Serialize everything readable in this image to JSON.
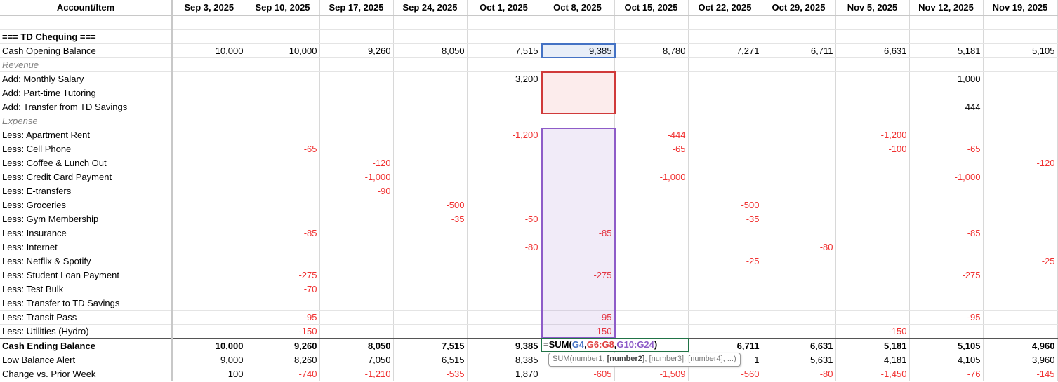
{
  "columns": [
    "Account/Item",
    "Sep 3, 2025",
    "Sep 10, 2025",
    "Sep 17, 2025",
    "Sep 24, 2025",
    "Oct 1, 2025",
    "Oct 8, 2025",
    "Oct 15, 2025",
    "Oct 22, 2025",
    "Oct 29, 2025",
    "Nov 5, 2025",
    "Nov 12, 2025",
    "Nov 19, 2025"
  ],
  "rows": [
    {
      "label": "",
      "style": "",
      "values": [
        "",
        "",
        "",
        "",
        "",
        "",
        "",
        "",
        "",
        "",
        "",
        ""
      ]
    },
    {
      "label": "=== TD Chequing ===",
      "style": "section",
      "values": [
        "",
        "",
        "",
        "",
        "",
        "",
        "",
        "",
        "",
        "",
        "",
        ""
      ]
    },
    {
      "label": "Cash Opening Balance",
      "style": "",
      "values": [
        "10,000",
        "10,000",
        "9,260",
        "8,050",
        "7,515",
        "9,385",
        "8,780",
        "7,271",
        "6,711",
        "6,631",
        "5,181",
        "5,105"
      ]
    },
    {
      "label": "Revenue",
      "style": "italic",
      "values": [
        "",
        "",
        "",
        "",
        "",
        "",
        "",
        "",
        "",
        "",
        "",
        ""
      ]
    },
    {
      "label": "Add: Monthly Salary",
      "style": "",
      "values": [
        "",
        "",
        "",
        "",
        "3,200",
        "",
        "",
        "",
        "",
        "",
        "1,000",
        ""
      ]
    },
    {
      "label": "Add: Part-time Tutoring",
      "style": "",
      "values": [
        "",
        "",
        "",
        "",
        "",
        "",
        "",
        "",
        "",
        "",
        "",
        ""
      ]
    },
    {
      "label": "Add: Transfer from TD Savings",
      "style": "",
      "values": [
        "",
        "",
        "",
        "",
        "",
        "",
        "",
        "",
        "",
        "",
        "444",
        ""
      ]
    },
    {
      "label": "Expense",
      "style": "italic",
      "values": [
        "",
        "",
        "",
        "",
        "",
        "",
        "",
        "",
        "",
        "",
        "",
        ""
      ]
    },
    {
      "label": "Less: Apartment Rent",
      "style": "",
      "values": [
        "",
        "",
        "",
        "",
        "-1,200",
        "",
        "-444",
        "",
        "",
        "-1,200",
        "",
        ""
      ]
    },
    {
      "label": "Less: Cell Phone",
      "style": "",
      "values": [
        "",
        "-65",
        "",
        "",
        "",
        "",
        "-65",
        "",
        "",
        "-100",
        "-65",
        ""
      ]
    },
    {
      "label": "Less: Coffee & Lunch Out",
      "style": "",
      "values": [
        "",
        "",
        "-120",
        "",
        "",
        "",
        "",
        "",
        "",
        "",
        "",
        "-120"
      ]
    },
    {
      "label": "Less: Credit Card Payment",
      "style": "",
      "values": [
        "",
        "",
        "-1,000",
        "",
        "",
        "",
        "-1,000",
        "",
        "",
        "",
        "-1,000",
        ""
      ]
    },
    {
      "label": "Less: E-transfers",
      "style": "",
      "values": [
        "",
        "",
        "-90",
        "",
        "",
        "",
        "",
        "",
        "",
        "",
        "",
        ""
      ]
    },
    {
      "label": "Less: Groceries",
      "style": "",
      "values": [
        "",
        "",
        "",
        "-500",
        "",
        "",
        "",
        "-500",
        "",
        "",
        "",
        ""
      ]
    },
    {
      "label": "Less: Gym Membership",
      "style": "",
      "values": [
        "",
        "",
        "",
        "-35",
        "-50",
        "",
        "",
        "-35",
        "",
        "",
        "",
        ""
      ]
    },
    {
      "label": "Less: Insurance",
      "style": "",
      "values": [
        "",
        "-85",
        "",
        "",
        "",
        "-85",
        "",
        "",
        "",
        "",
        "-85",
        ""
      ]
    },
    {
      "label": "Less: Internet",
      "style": "",
      "values": [
        "",
        "",
        "",
        "",
        "-80",
        "",
        "",
        "",
        "-80",
        "",
        "",
        ""
      ]
    },
    {
      "label": "Less: Netflix & Spotify",
      "style": "",
      "values": [
        "",
        "",
        "",
        "",
        "",
        "",
        "",
        "-25",
        "",
        "",
        "",
        "-25"
      ]
    },
    {
      "label": "Less: Student Loan Payment",
      "style": "",
      "values": [
        "",
        "-275",
        "",
        "",
        "",
        "-275",
        "",
        "",
        "",
        "",
        "-275",
        ""
      ]
    },
    {
      "label": "Less: Test Bulk",
      "style": "",
      "values": [
        "",
        "-70",
        "",
        "",
        "",
        "",
        "",
        "",
        "",
        "",
        "",
        ""
      ]
    },
    {
      "label": "Less: Transfer to TD Savings",
      "style": "",
      "values": [
        "",
        "",
        "",
        "",
        "",
        "",
        "",
        "",
        "",
        "",
        "",
        ""
      ]
    },
    {
      "label": "Less: Transit Pass",
      "style": "",
      "values": [
        "",
        "-95",
        "",
        "",
        "",
        "-95",
        "",
        "",
        "",
        "",
        "-95",
        ""
      ]
    },
    {
      "label": "Less: Utilities (Hydro)",
      "style": "",
      "values": [
        "",
        "-150",
        "",
        "",
        "",
        "-150",
        "",
        "",
        "",
        "-150",
        "",
        ""
      ]
    },
    {
      "label": "Cash Ending Balance",
      "style": "ending",
      "values": [
        "10,000",
        "9,260",
        "8,050",
        "7,515",
        "9,385",
        "",
        "",
        "6,711",
        "6,631",
        "5,181",
        "5,105",
        "4,960"
      ]
    },
    {
      "label": "Low Balance Alert",
      "style": "",
      "values": [
        "9,000",
        "8,260",
        "7,050",
        "6,515",
        "8,385",
        "",
        "",
        "1",
        "5,631",
        "4,181",
        "4,105",
        "3,960"
      ]
    },
    {
      "label": "Change vs. Prior Week",
      "style": "",
      "values": [
        "100",
        "-740",
        "-1,210",
        "-535",
        "1,870",
        "-605",
        "-1,509",
        "-560",
        "-80",
        "-1,450",
        "-76",
        "-145"
      ]
    }
  ],
  "formula_edit": {
    "prefix": "=SUM(",
    "ref1": "G4",
    "sep1": ",",
    "ref2": "G6:G8",
    "sep2": ",",
    "ref3": "G10:G24",
    "suffix": ")",
    "colors": {
      "ref1": "#4472c4",
      "ref2": "#e04040",
      "ref3": "#8e5cc8"
    }
  },
  "tooltip": {
    "func": "SUM(number1, ",
    "bold": "[number2]",
    "rest": ", [number3], [number4], ...)"
  }
}
